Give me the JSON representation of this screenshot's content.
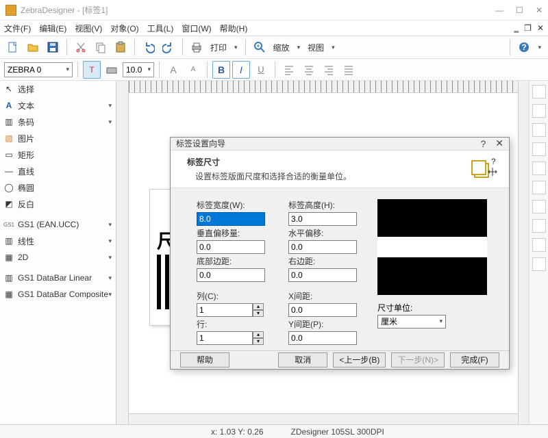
{
  "app": {
    "title": "ZebraDesigner - [标签1]"
  },
  "window_buttons": {
    "min": "—",
    "max": "☐",
    "close": "✕"
  },
  "menu": {
    "file": "文件(F)",
    "edit": "编辑(E)",
    "view": "视图(V)",
    "object": "对象(O)",
    "tools": "工具(L)",
    "window": "窗口(W)",
    "help": "帮助(H)"
  },
  "toolbar": {
    "print": "打印",
    "zoom": "缩放",
    "view": "视图",
    "printer_combo": "ZEBRA 0",
    "font_size": "10.0"
  },
  "sidebar": {
    "items": [
      {
        "label": "选择",
        "icon": "cursor"
      },
      {
        "label": "文本",
        "icon": "text"
      },
      {
        "label": "条码",
        "icon": "barcode"
      },
      {
        "label": "图片",
        "icon": "image"
      },
      {
        "label": "矩形",
        "icon": "rect"
      },
      {
        "label": "直线",
        "icon": "line"
      },
      {
        "label": "椭圆",
        "icon": "ellipse"
      },
      {
        "label": "反白",
        "icon": "invert"
      },
      {
        "label": "GS1 (EAN.UCC)",
        "icon": "gs1"
      },
      {
        "label": "线性",
        "icon": "linear"
      },
      {
        "label": "2D",
        "icon": "2d"
      },
      {
        "label": "GS1 DataBar Linear",
        "icon": "databar"
      },
      {
        "label": "GS1 DataBar Composite",
        "icon": "databarc"
      }
    ]
  },
  "canvas": {
    "sample_text": "尺"
  },
  "dialog": {
    "title": "标签设置向导",
    "heading": "标签尺寸",
    "subheading": "设置标签版面尺度和选择合适的衡量单位。",
    "fields": {
      "width_label": "标签宽度(W):",
      "width_value": "8.0",
      "height_label": "标签高度(H):",
      "height_value": "3.0",
      "voffset_label": "垂直偏移量:",
      "voffset_value": "0.0",
      "hoffset_label": "水平偏移:",
      "hoffset_value": "0.0",
      "bottom_label": "底部边距:",
      "bottom_value": "0.0",
      "right_label": "右边距:",
      "right_value": "0.0",
      "cols_label": "列(C):",
      "cols_value": "1",
      "xgap_label": "X间距:",
      "xgap_value": "0.0",
      "rows_label": "行:",
      "rows_value": "1",
      "ygap_label": "Y间距(P):",
      "ygap_value": "0.0",
      "unit_label": "尺寸单位:",
      "unit_value": "厘米"
    },
    "buttons": {
      "help": "帮助",
      "cancel": "取消",
      "back": "<上一步(B)",
      "next": "下一步(N)>",
      "finish": "完成(F)"
    }
  },
  "status": {
    "coords": "x: 1.03 Y: 0.26",
    "printer": "ZDesigner 105SL 300DPI"
  }
}
